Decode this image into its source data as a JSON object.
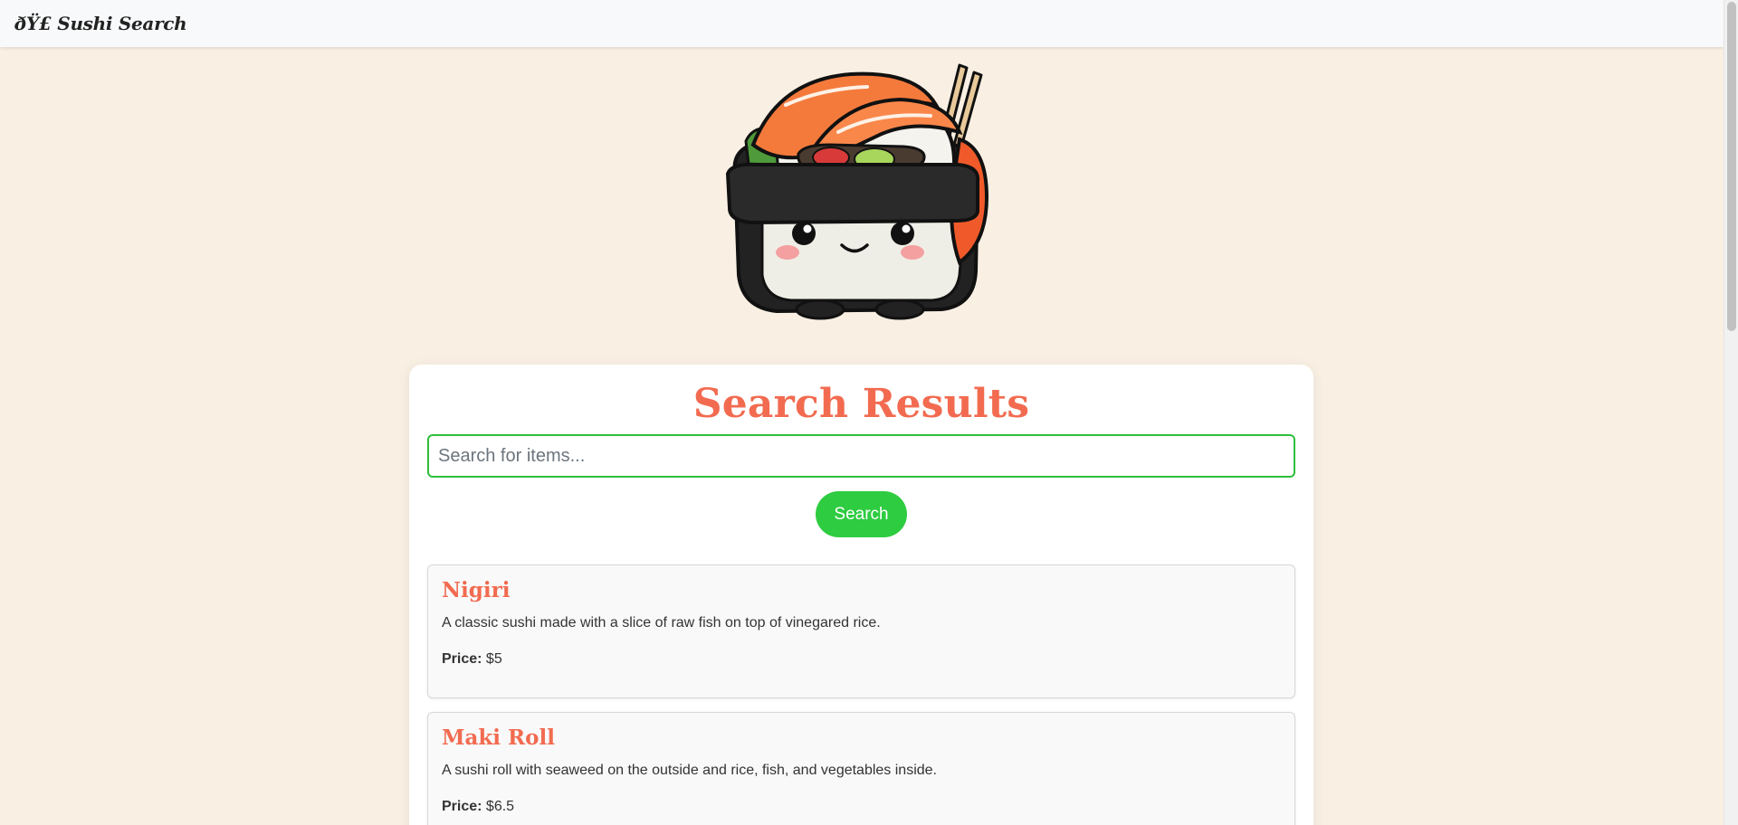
{
  "navbar": {
    "brand": "ðŸ£ Sushi Search"
  },
  "mascot": {
    "icon": "sushi-mascot-icon"
  },
  "results": {
    "title": "Search Results",
    "search_placeholder": "Search for items...",
    "search_value": "",
    "search_button": "Search"
  },
  "items": [
    {
      "name": "Nigiri",
      "description": "A classic sushi made with a slice of raw fish on top of vinegared rice.",
      "price_label": "Price:",
      "price": "$5"
    },
    {
      "name": "Maki Roll",
      "description": "A sushi roll with seaweed on the outside and rice, fish, and vegetables inside.",
      "price_label": "Price:",
      "price": "$6.5"
    }
  ],
  "colors": {
    "accent": "#f26b50",
    "button": "#2ecc40",
    "input_border": "#2fbf3b",
    "background": "#f9f0e3"
  }
}
